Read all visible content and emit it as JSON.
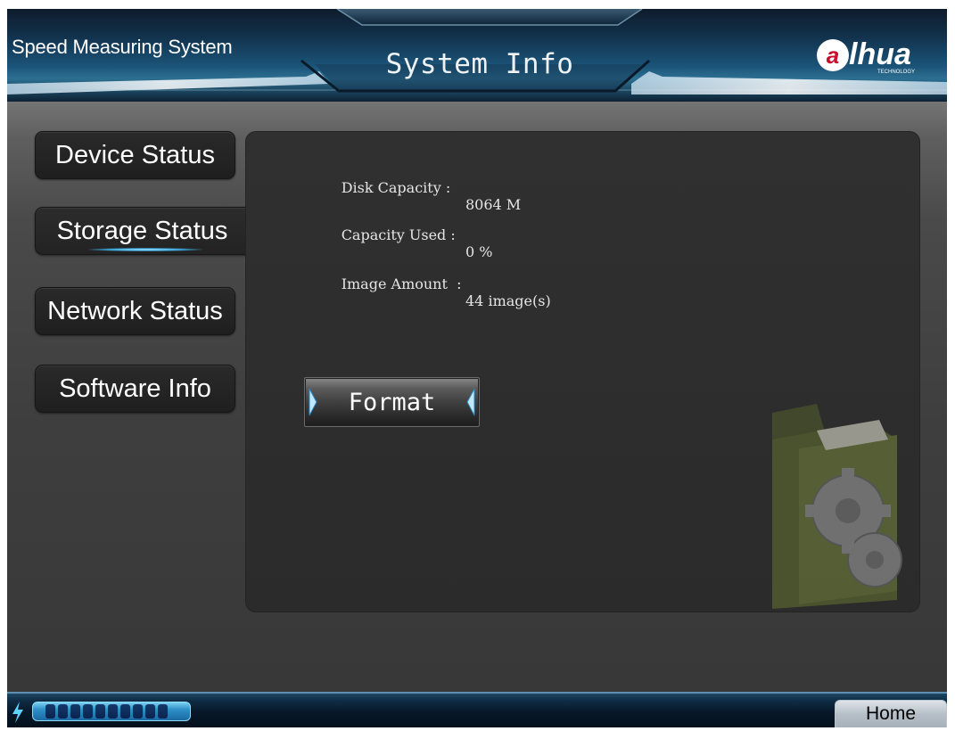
{
  "header": {
    "app_name": "Speed Measuring System",
    "page_title": "System Info",
    "logo_text": "alhua",
    "logo_subtext": "TECHNOLOGY"
  },
  "sidebar": {
    "active": "Storage Status",
    "tabs": [
      {
        "label": "Device Status"
      },
      {
        "label": "Storage Status"
      },
      {
        "label": "Network Status"
      },
      {
        "label": "Software Info"
      }
    ]
  },
  "storage": {
    "rows": [
      {
        "label": "Disk Capacity :",
        "value": "8064 M"
      },
      {
        "label": "Capacity Used :",
        "value": "0 %"
      },
      {
        "label": "Image Amount  :",
        "value": "44 image(s)"
      }
    ],
    "format_label": "Format"
  },
  "footer": {
    "home_label": "Home",
    "progress_segments": 10
  },
  "colors": {
    "accent": "#2e8fc7",
    "panel": "#2e2e2e",
    "header": "#1b5478"
  }
}
